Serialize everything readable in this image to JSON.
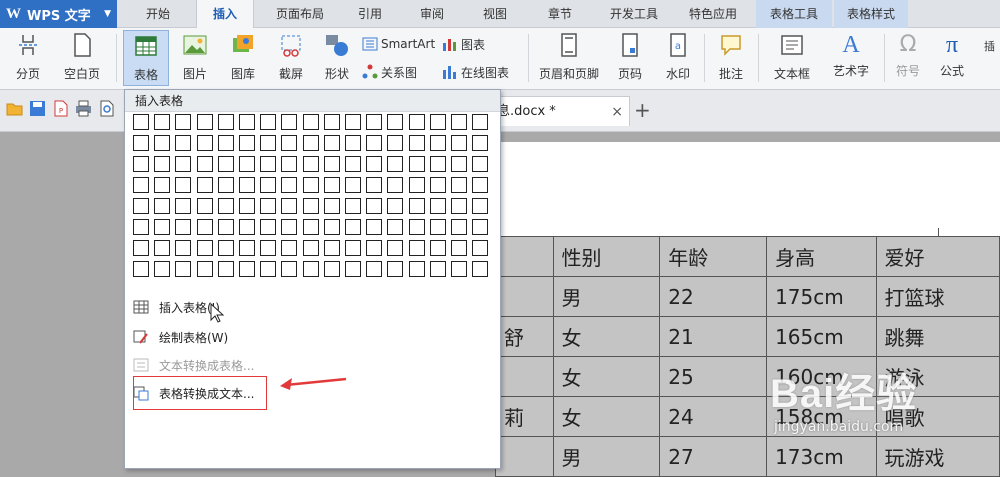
{
  "app": {
    "name": "WPS 文字",
    "logo": "W"
  },
  "tabs": [
    "开始",
    "插入",
    "页面布局",
    "引用",
    "审阅",
    "视图",
    "章节",
    "开发工具",
    "特色应用",
    "表格工具",
    "表格样式"
  ],
  "active_tab": "插入",
  "ribbon": {
    "page_break": "分页",
    "blank_page": "空白页",
    "table": "表格",
    "picture": "图片",
    "gallery": "图库",
    "screenshot": "截屏",
    "shape": "形状",
    "smartart": "SmartArt",
    "chart": "图表",
    "relation": "关系图",
    "online_chart": "在线图表",
    "header_footer": "页眉和页脚",
    "page_number": "页码",
    "watermark": "水印",
    "comment": "批注",
    "textbox": "文本框",
    "wordart": "艺术字",
    "symbol": "符号",
    "formula": "公式",
    "insert_num": "插",
    "symbol_glyph": "Ω",
    "formula_glyph": "π",
    "wordart_glyph": "A"
  },
  "document_tab": {
    "name": "息.docx *",
    "close": "×",
    "new": "+"
  },
  "dropdown": {
    "title": "插入表格",
    "items": [
      {
        "label": "插入表格(I)",
        "enabled": true
      },
      {
        "label": "绘制表格(W)",
        "enabled": true
      },
      {
        "label": "文本转换成表格...",
        "enabled": false
      },
      {
        "label": "表格转换成文本...",
        "enabled": true
      }
    ]
  },
  "doc_table": {
    "rows": [
      [
        "",
        "性别",
        "年龄",
        "身高",
        "爱好"
      ],
      [
        "",
        "男",
        "22",
        "175cm",
        "打篮球"
      ],
      [
        "舒",
        "女",
        "21",
        "165cm",
        "跳舞"
      ],
      [
        "",
        "女",
        "25",
        "160cm",
        "游泳"
      ],
      [
        "莉",
        "女",
        "24",
        "158cm",
        "唱歌"
      ],
      [
        "",
        "男",
        "27",
        "173cm",
        "玩游戏"
      ]
    ]
  },
  "watermark": {
    "brand": "Bai经验",
    "url": "jingyan.baidu.com"
  },
  "colors": {
    "accent": "#2f6fc4",
    "highlight": "#e23a3a",
    "table_bg": "#c4c4c4"
  }
}
